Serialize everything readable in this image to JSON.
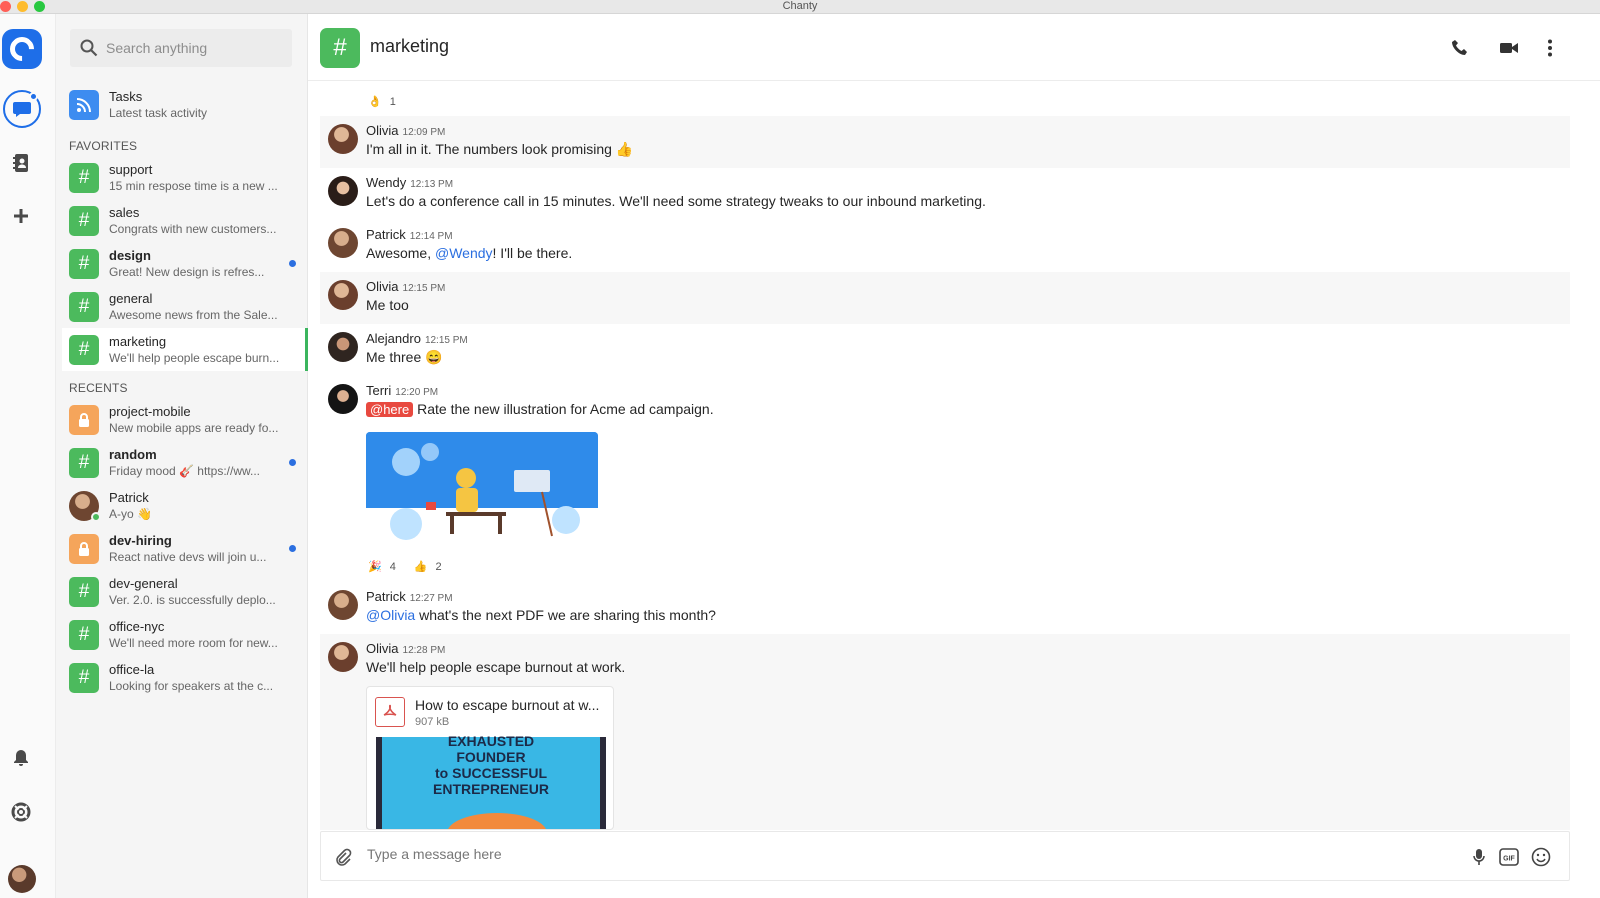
{
  "window": {
    "title": "Chanty",
    "dot_colors": [
      "#ff5f57",
      "#febc2e",
      "#28c840"
    ]
  },
  "colors": {
    "accent": "#1e6ee8",
    "channel_green": "#4cba5d",
    "private_orange": "#f5a55b",
    "mention_blue": "#2b6fe0",
    "here_red": "#e8493f"
  },
  "rail": {
    "icons": [
      "chanty-logo-icon",
      "chat-bubble-icon",
      "contacts-book-icon",
      "plus-icon",
      "bell-icon",
      "lifebuoy-icon",
      "user-avatar"
    ]
  },
  "search": {
    "placeholder": "Search anything"
  },
  "tasks": {
    "name": "Tasks",
    "preview": "Latest task activity"
  },
  "favorites": {
    "label": "FAVORITES",
    "items": [
      {
        "name": "support",
        "preview": "15 min respose time is a new ...",
        "unread": false
      },
      {
        "name": "sales",
        "preview": "Congrats with new customers...",
        "unread": false
      },
      {
        "name": "design",
        "preview": "Great! New design is refres...",
        "unread": true
      },
      {
        "name": "general",
        "preview": "Awesome news from the Sale...",
        "unread": false
      },
      {
        "name": "marketing",
        "preview": "We'll help people escape burn...",
        "unread": false,
        "active": true
      }
    ]
  },
  "recents": {
    "label": "RECENTS",
    "items": [
      {
        "name": "project-mobile",
        "preview": "New mobile apps are ready fo...",
        "kind": "private"
      },
      {
        "name": "random",
        "preview": "Friday mood 🎸 https://ww...",
        "kind": "channel",
        "unread": true
      },
      {
        "name": "Patrick",
        "preview": "A-yo 👋",
        "kind": "person"
      },
      {
        "name": "dev-hiring",
        "preview": "React native devs will join u...",
        "kind": "private",
        "unread": true
      },
      {
        "name": "dev-general",
        "preview": "Ver. 2.0. is successfully deplo...",
        "kind": "channel"
      },
      {
        "name": "office-nyc",
        "preview": "We'll need more room for new...",
        "kind": "channel"
      },
      {
        "name": "office-la",
        "preview": "Looking for speakers at the c...",
        "kind": "channel"
      }
    ]
  },
  "channel": {
    "hash": "#",
    "name": "marketing"
  },
  "feed": {
    "top_reaction": {
      "emoji": "👌",
      "count": "1"
    },
    "messages": [
      {
        "author": "Olivia",
        "time": "12:09 PM",
        "text": "I'm all in it. The numbers look promising 👍"
      },
      {
        "author": "Wendy",
        "time": "12:13 PM",
        "text": "Let's do a conference call in 15 minutes. We'll need some strategy tweaks to our inbound marketing."
      },
      {
        "author": "Patrick",
        "time": "12:14 PM",
        "text_before": "Awesome, ",
        "mention": "@Wendy",
        "text_after": "! I'll be there."
      },
      {
        "author": "Olivia",
        "time": "12:15 PM",
        "text": "Me too"
      },
      {
        "author": "Alejandro",
        "time": "12:15 PM",
        "text": "Me three 😄"
      },
      {
        "author": "Terri",
        "time": "12:20 PM",
        "badge": "@here",
        "text": " Rate the new illustration for Acme ad campaign."
      },
      {
        "author": "Patrick",
        "time": "12:27 PM",
        "mention": "@Olivia",
        "text_after": " what's the next PDF we are sharing this month?"
      },
      {
        "author": "Olivia",
        "time": "12:28 PM",
        "text": "We'll help people escape burnout at work."
      }
    ],
    "image_reactions": [
      {
        "emoji": "🎉",
        "count": "4"
      },
      {
        "emoji": "👍",
        "count": "2"
      }
    ],
    "file": {
      "name": "How to escape burnout at w...",
      "size": "907 kB",
      "thumb_lines": [
        "EXHAUSTED",
        "FOUNDER",
        "to SUCCESSFUL",
        "ENTREPRENEUR"
      ]
    }
  },
  "composer": {
    "placeholder": "Type a message here"
  }
}
